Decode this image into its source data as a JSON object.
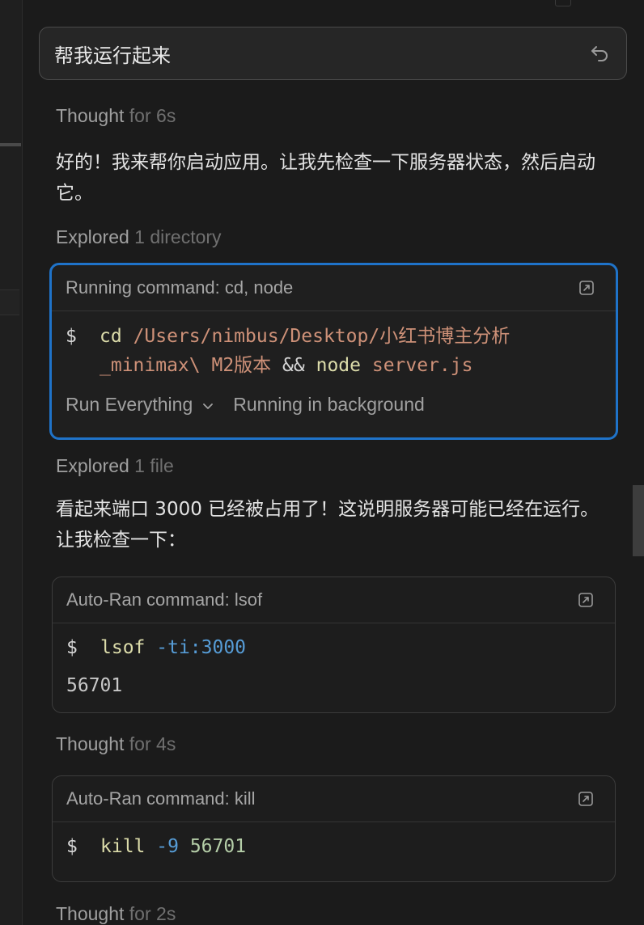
{
  "user_message": {
    "text": "帮我运行起来"
  },
  "steps": {
    "thought1": {
      "label": "Thought",
      "duration": "for 6s"
    },
    "reply1": "好的！我来帮你启动应用。让我先检查一下服务器状态，然后启动它。",
    "explored1": {
      "label": "Explored",
      "detail": "1 directory"
    },
    "cmd1": {
      "header": "Running command: cd, node",
      "prompt": "$",
      "tokens": {
        "cd": "cd",
        "path_line1": "/Users/nimbus/Desktop/小红书博主分析",
        "path_line2": "_minimax\\ M2版本",
        "op": "&&",
        "node": "node",
        "file": "server.js"
      },
      "run_mode": "Run Everything",
      "status": "Running in background"
    },
    "explored2": {
      "label": "Explored",
      "detail": "1 file"
    },
    "reply2": "看起来端口 3000 已经被占用了！这说明服务器可能已经在运行。让我检查一下：",
    "cmd2": {
      "header": "Auto-Ran command: lsof",
      "prompt": "$",
      "cmd": "lsof",
      "args": "-ti:3000",
      "output": "56701"
    },
    "thought2": {
      "label": "Thought",
      "duration": "for 4s"
    },
    "cmd3": {
      "header": "Auto-Ran command: kill",
      "prompt": "$",
      "cmd": "kill",
      "flag": "-9",
      "pid": "56701"
    },
    "thought3": {
      "label": "Thought",
      "duration": "for 2s"
    }
  },
  "icons": {
    "undo": "undo-arrow-icon",
    "open_external": "open-in-terminal-icon",
    "chevron": "chevron-down-icon"
  },
  "colors": {
    "active_border": "#1f73c9",
    "command_token": "#dcdcaa",
    "path_token": "#ce9178",
    "flag_token": "#569cd6",
    "number_token": "#b5cea8"
  }
}
